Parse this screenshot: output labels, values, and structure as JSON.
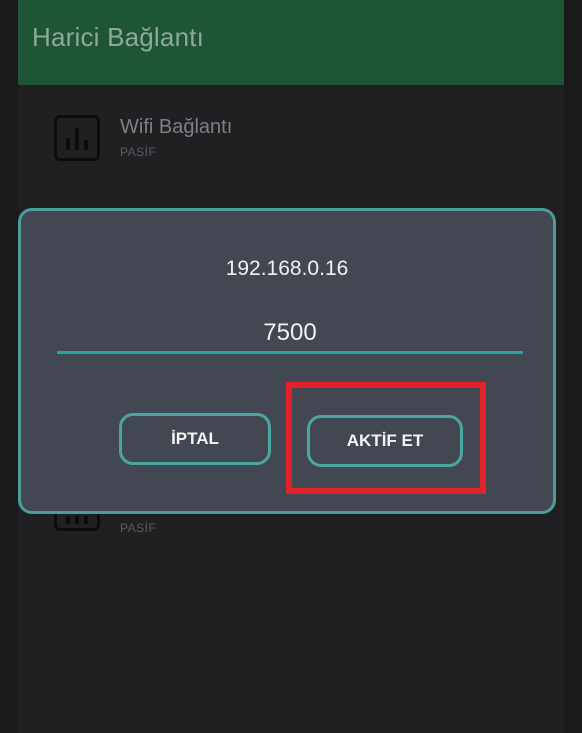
{
  "appbar": {
    "title": "Harici Bağlantı"
  },
  "list": {
    "items": [
      {
        "title": "Wifi Bağlantı",
        "status": "PASİF"
      },
      {
        "title": "",
        "status": "PASİF"
      }
    ]
  },
  "dialog": {
    "ip_address": "192.168.0.16",
    "port_value": "7500",
    "cancel_label": "İPTAL",
    "activate_label": "AKTİF ET"
  },
  "colors": {
    "appbar": "#1e5535",
    "accent": "#1fa7a6",
    "dialog_bg": "#434751",
    "highlight": "#e0222a"
  },
  "icons": {
    "list_item": "bar-chart-icon"
  }
}
